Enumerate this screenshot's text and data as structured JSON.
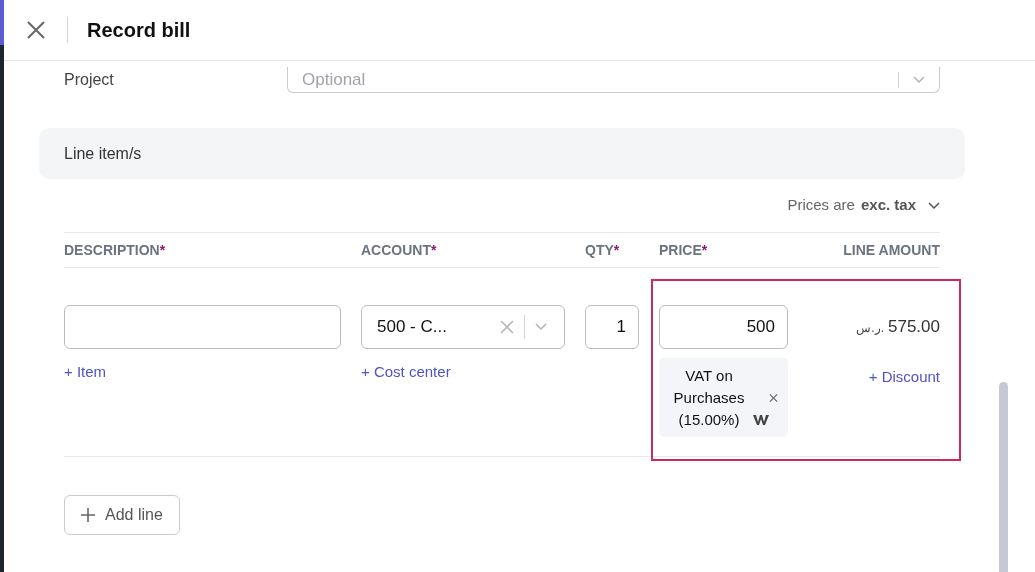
{
  "header": {
    "title": "Record bill"
  },
  "project": {
    "label": "Project",
    "placeholder": "Optional"
  },
  "line_items": {
    "title": "Line item/s",
    "prices_mode": {
      "prefix": "Prices are",
      "value": "exc. tax"
    },
    "columns": [
      {
        "label": "DESCRIPTION",
        "required_mark": "*"
      },
      {
        "label": "ACCOUNT",
        "required_mark": "*"
      },
      {
        "label": "QTY",
        "required_mark": "*"
      },
      {
        "label": "PRICE",
        "required_mark": "*"
      },
      {
        "label": "LINE AMOUNT"
      }
    ],
    "rows": [
      {
        "item_link": "+ Item",
        "account": "500 - C...",
        "cost_center_link": "+ Cost center",
        "qty": "1",
        "price": "500",
        "tax": "VAT on Purchases (15.00%)",
        "currency": "ر.س.",
        "amount": "575.00",
        "discount_link": "+ Discount",
        "highlighted": true
      }
    ],
    "add_line": "Add line"
  }
}
